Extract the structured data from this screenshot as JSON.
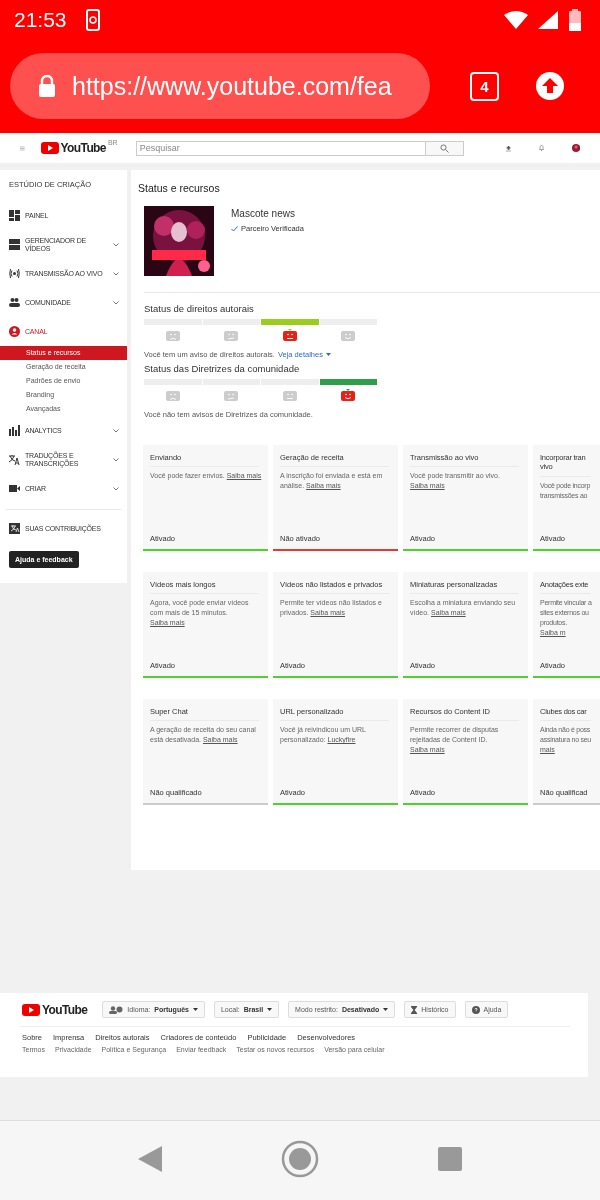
{
  "status_bar": {
    "time": "21:53"
  },
  "browser": {
    "url": "https://www.youtube.com/fea",
    "tab_count": "4"
  },
  "header": {
    "logo": "YouTube",
    "region": "BR",
    "search": {
      "placeholder": "Pesquisar"
    }
  },
  "sidebar": {
    "title": "ESTÚDIO DE CRIAÇÃO",
    "items": [
      {
        "label": "PAINEL",
        "expandable": false,
        "selected": false
      },
      {
        "label": "GERENCIADOR DE VÍDEOS",
        "expandable": true,
        "selected": false
      },
      {
        "label": "TRANSMISSÃO AO VIVO",
        "expandable": true,
        "selected": false
      },
      {
        "label": "COMUNIDADE",
        "expandable": true,
        "selected": false
      },
      {
        "label": "CANAL",
        "expandable": false,
        "selected": true,
        "children": [
          {
            "label": "Status e recursos",
            "selected": true
          },
          {
            "label": "Geração de receita",
            "selected": false
          },
          {
            "label": "Padrões de envio",
            "selected": false
          },
          {
            "label": "Branding",
            "selected": false
          },
          {
            "label": "Avançadas",
            "selected": false
          }
        ]
      },
      {
        "label": "ANALYTICS",
        "expandable": true,
        "selected": false
      },
      {
        "label": "TRADUÇÕES E TRANSCRIÇÕES",
        "expandable": true,
        "selected": false
      },
      {
        "label": "CRIAR",
        "expandable": true,
        "selected": false
      }
    ],
    "contributions": "SUAS CONTRIBUIÇÕES",
    "help_button": "Ajuda e feedback"
  },
  "main": {
    "title": "Status e recursos",
    "channel": {
      "name": "Mascote news",
      "badge": "Parceiro Verificada"
    },
    "meters": [
      {
        "title": "Status de direitos autorais",
        "color": "#9acd1e",
        "segments": [
          {
            "selected": false
          },
          {
            "selected": false
          },
          {
            "selected": true
          },
          {
            "selected": false
          }
        ],
        "note": "Você tem um aviso de direitos autorais.",
        "link": "Veja detalhes"
      },
      {
        "title": "Status das Diretrizes da comunidade",
        "color": "#2e9e48",
        "segments": [
          {
            "selected": false
          },
          {
            "selected": false
          },
          {
            "selected": false
          },
          {
            "selected": true
          }
        ],
        "note": "Você não tem avisos de Diretrizes da comunidade."
      }
    ],
    "features": [
      {
        "title": "Enviando",
        "text": "Você pode fazer envios.",
        "link": "Saiba mais",
        "status": "Ativado",
        "kind": "enabled"
      },
      {
        "title": "Geração de receita",
        "text": "A inscrição foi enviada e está em análise.",
        "link": "Saiba mais",
        "status": "Não ativado",
        "kind": "disabled"
      },
      {
        "title": "Transmissão ao vivo",
        "text": "Você pode transmitir ao vivo.",
        "link": "Saiba mais",
        "status": "Ativado",
        "kind": "enabled"
      },
      {
        "title_lines": [
          "Incorporar tran",
          "vivo"
        ],
        "lines": [
          "Você pode incorp",
          "transmissões ao"
        ],
        "status": "Ativado",
        "kind": "enabled"
      },
      {
        "title": "Vídeos mais longos",
        "text": "Agora, você pode enviar vídeos com mais de 15 minutos.",
        "link": "Saiba mais",
        "status": "Ativado",
        "kind": "enabled"
      },
      {
        "title": "Vídeos não listados e privados",
        "text": "Permite ter vídeos não listados e privados.",
        "link": "Saiba mais",
        "status": "Ativado",
        "kind": "enabled"
      },
      {
        "title": "Miniaturas personalizadas",
        "text": "Escolha a miniatura enviando seu vídeo.",
        "link": "Saiba mais",
        "status": "Ativado",
        "kind": "enabled"
      },
      {
        "title_lines": [
          "Anotações exte"
        ],
        "lines": [
          "Permite vincular a",
          "sites externos ou",
          "produtos."
        ],
        "link": "Saiba m",
        "status": "Ativado",
        "kind": "enabled"
      },
      {
        "title": "Super Chat",
        "text": "A geração de receita do seu canal está desativada.",
        "link": "Saiba mais",
        "status": "Não qualificado",
        "kind": "ineligible"
      },
      {
        "title": "URL personalizado",
        "text": "Você já reivindicou um URL personalizado:",
        "link": "Luckyfire",
        "status": "Ativado",
        "kind": "enabled"
      },
      {
        "title": "Recursos do Content ID",
        "text": "Permite recorrer de disputas rejeitadas de Content ID.",
        "link": "Saiba mais",
        "status": "Ativado",
        "kind": "enabled"
      },
      {
        "title_lines": [
          "Clubes dos car"
        ],
        "lines": [
          "Ainda não é poss",
          "assinatura no seu"
        ],
        "link": "mais",
        "status": "Não qualificad",
        "kind": "ineligible"
      }
    ]
  },
  "footer": {
    "logo": "YouTube",
    "buttons": [
      {
        "kind": "language",
        "label": "Idioma:",
        "value": "Português"
      },
      {
        "kind": "dropdown",
        "label": "Local:",
        "value": "Brasil"
      },
      {
        "kind": "dropdown",
        "label": "Modo restrito:",
        "value": "Desativado"
      },
      {
        "kind": "history",
        "label": "Histórico"
      },
      {
        "kind": "help",
        "label": "Ajuda"
      }
    ],
    "links": [
      "Sobre",
      "Imprensa",
      "Direitos autorais",
      "Criadores de conteúdo",
      "Publicidade",
      "Desenvolvedores"
    ],
    "small_links": [
      "Termos",
      "Privacidade",
      "Política e Segurança",
      "Enviar feedback",
      "Testar os novos recursos",
      "Versão para celular"
    ]
  }
}
